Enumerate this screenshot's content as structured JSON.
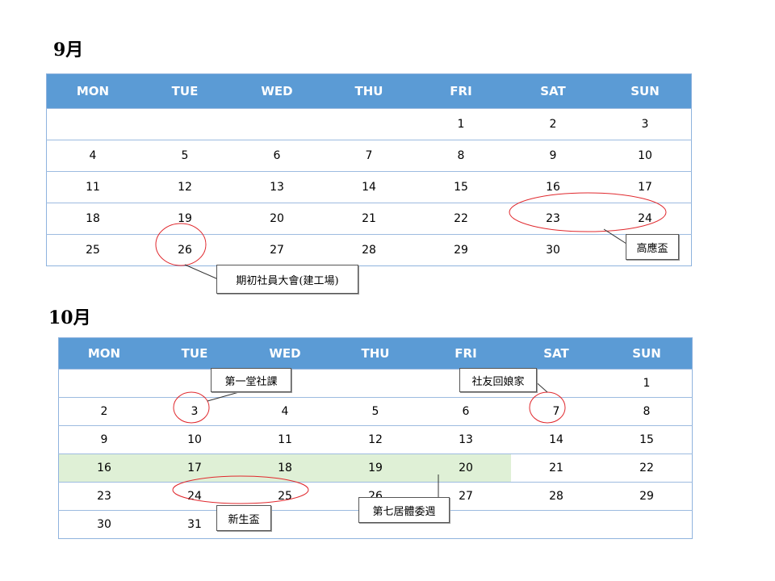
{
  "september": {
    "title": "9月",
    "weekdays": [
      "MON",
      "TUE",
      "WED",
      "THU",
      "FRI",
      "SAT",
      "SUN"
    ],
    "weeks": [
      [
        "",
        "",
        "",
        "",
        "1",
        "2",
        "3"
      ],
      [
        "4",
        "5",
        "6",
        "7",
        "8",
        "9",
        "10"
      ],
      [
        "11",
        "12",
        "13",
        "14",
        "15",
        "16",
        "17"
      ],
      [
        "18",
        "19",
        "20",
        "21",
        "22",
        "23",
        "24"
      ],
      [
        "25",
        "26",
        "27",
        "28",
        "29",
        "30",
        ""
      ]
    ],
    "callouts": {
      "recruit_meeting": "期初社員大會(建工場)",
      "gaoying_cup": "高應盃"
    }
  },
  "october": {
    "title": "10月",
    "weekdays": [
      "MON",
      "TUE",
      "WED",
      "THU",
      "FRI",
      "SAT",
      "SUN"
    ],
    "weeks": [
      [
        "",
        "",
        "",
        "",
        "",
        "",
        "1"
      ],
      [
        "2",
        "3",
        "4",
        "5",
        "6",
        "7",
        "8"
      ],
      [
        "9",
        "10",
        "11",
        "12",
        "13",
        "14",
        "15"
      ],
      [
        "16",
        "17",
        "18",
        "19",
        "20",
        "21",
        "22"
      ],
      [
        "23",
        "24",
        "25",
        "26",
        "27",
        "28",
        "29"
      ],
      [
        "30",
        "31",
        "",
        "",
        "",
        "",
        ""
      ]
    ],
    "callouts": {
      "first_class": "第一堂社課",
      "alumni_return": "社友回娘家",
      "freshman_cup": "新生盃",
      "sports_week": "第七居體委週"
    }
  },
  "colors": {
    "header_bg": "#5b9bd5",
    "shade": "#dff0d6",
    "circle": "#e0282d"
  }
}
